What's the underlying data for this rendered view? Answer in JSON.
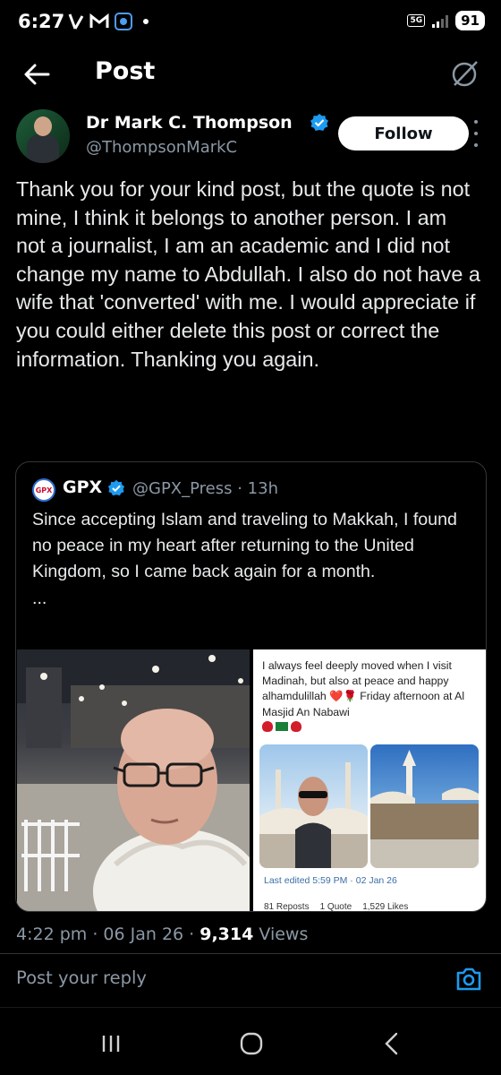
{
  "status_bar": {
    "time": "6:27",
    "network": "5G",
    "battery": "91"
  },
  "top_bar": {
    "title": "Post"
  },
  "author": {
    "name": "Dr Mark C. Thompson",
    "handle": "@ThompsonMarkC",
    "follow_label": "Follow"
  },
  "post": {
    "text": "Thank you for your kind post, but the quote is not mine, I think it belongs to another person. I am not a journalist, I am an academic and I did not change my name to Abdullah. I also do not have a wife that 'converted' with me. I would appreciate if you could either delete this post or correct the information. Thanking you again."
  },
  "quote": {
    "avatar_text": "GPX",
    "name": "GPX",
    "handle_time": "@GPX_Press · 13h",
    "text": "Since accepting Islam and traveling to Makkah, I found no peace in my heart after returning to the United Kingdom, so I came back again for a month.",
    "ellipsis": "...",
    "screenshot": {
      "text": "I always feel deeply moved when I visit Madinah, but also at peace and happy alhamdulillah ❤️🌹 Friday afternoon at Al Masjid An Nabawi",
      "edited": "Last edited 5:59 PM · 02 Jan 26",
      "reposts": "81 Reposts",
      "quotes": "1 Quote",
      "likes": "1,529 Likes"
    }
  },
  "meta": {
    "time_date": "4:22 pm · 06 Jan 26 · ",
    "views_count": "9,314",
    "views_label": " Views"
  },
  "reply": {
    "placeholder": "Post your reply"
  }
}
